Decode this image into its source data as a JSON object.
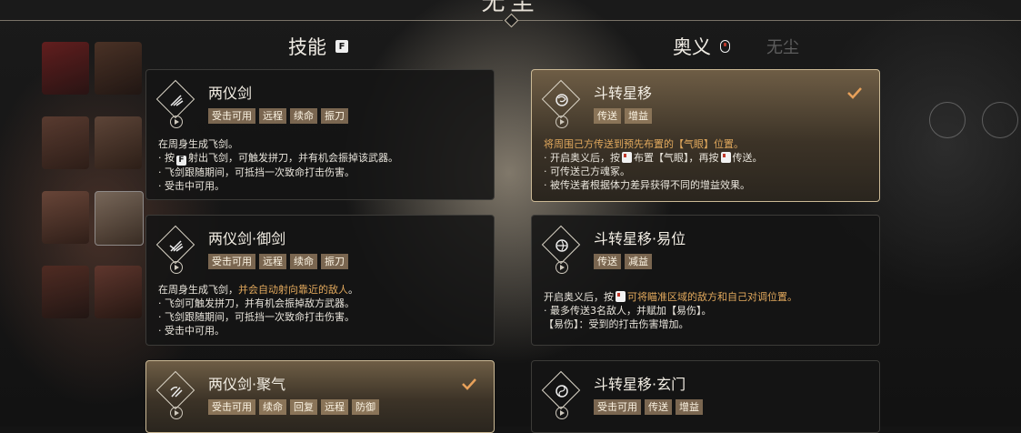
{
  "header": {
    "title": "无尘"
  },
  "columns": {
    "skills": {
      "title": "技能",
      "key": "F"
    },
    "ultimate": {
      "title": "奥义"
    }
  },
  "background_name": "无尘",
  "skills": [
    {
      "name": "两仪剑",
      "tags": [
        "受击可用",
        "远程",
        "续命",
        "振刀"
      ],
      "selected": false,
      "desc": {
        "l1": "在周身生成飞剑。",
        "l2a": "· 按",
        "l2key": "F",
        "l2b": "射出飞剑，可触发拼刀，并有机会振掉该武器。",
        "l3": "· 飞剑跟随期间，可抵挡一次致命打击伤害。",
        "l4": "· 受击中可用。"
      }
    },
    {
      "name": "两仪剑·御剑",
      "tags": [
        "受击可用",
        "远程",
        "续命",
        "振刀"
      ],
      "selected": false,
      "desc": {
        "l1a": "在周身生成飞剑，",
        "l1hl": "并会自动射向靠近的敌人",
        "l1b": "。",
        "l2": "· 飞剑可触发拼刀，并有机会振掉敌方武器。",
        "l3": "· 飞剑跟随期间，可抵挡一次致命打击伤害。",
        "l4": "· 受击中可用。"
      }
    },
    {
      "name": "两仪剑·聚气",
      "tags": [
        "受击可用",
        "续命",
        "回复",
        "远程",
        "防御"
      ],
      "selected": true
    }
  ],
  "ultimates": [
    {
      "name": "斗转星移",
      "tags": [
        "传送",
        "增益"
      ],
      "selected": true,
      "desc": {
        "l1": "将周围己方传送到预先布置的【气眼】位置。",
        "l2a": "· 开启奥义后，按",
        "l2b": "布置【气眼】，再按",
        "l2c": "传送。",
        "l3": "· 可传送己方魂冢。",
        "l4": "· 被传送者根据体力差异获得不同的增益效果。"
      }
    },
    {
      "name": "斗转星移·易位",
      "tags": [
        "传送",
        "减益"
      ],
      "selected": false,
      "desc": {
        "l1a": "开启奥义后，按",
        "l1hl": "可将瞄准区域的敌方和自己对调位置。",
        "l2": "· 最多传送3名敌人，并赋加【易伤】。",
        "l3": "【易伤】：受到的打击伤害增加。"
      }
    },
    {
      "name": "斗转星移·玄门",
      "tags": [
        "受击可用",
        "传送",
        "增益"
      ],
      "selected": false
    }
  ],
  "colors": {
    "accent": "#e2a95d",
    "tag": "#7a6650",
    "check": "#e8a15a"
  }
}
